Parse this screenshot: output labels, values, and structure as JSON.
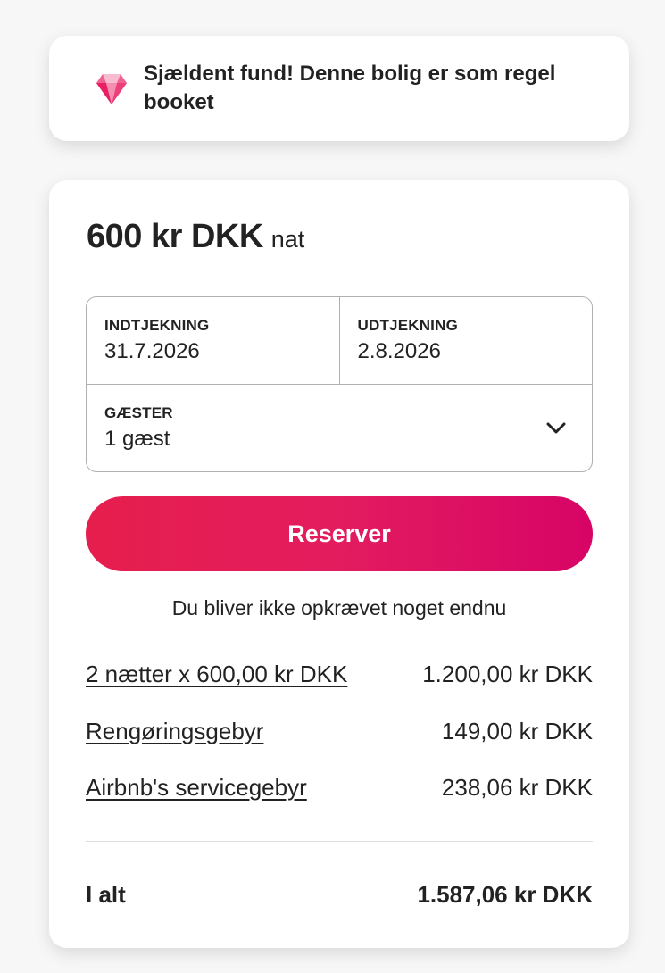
{
  "notice": {
    "icon": "gem-icon",
    "text": "Sjældent fund! Denne bolig er som regel booket"
  },
  "booking": {
    "price": "600 kr DKK",
    "price_unit": "nat",
    "checkin": {
      "label": "INDTJEKNING",
      "value": "31.7.2026"
    },
    "checkout": {
      "label": "UDTJEKNING",
      "value": "2.8.2026"
    },
    "guests": {
      "label": "GÆSTER",
      "value": "1 gæst"
    },
    "reserve_label": "Reserver",
    "no_charge_text": "Du bliver ikke opkrævet noget endnu",
    "fees": [
      {
        "label": "2 nætter x 600,00 kr DKK",
        "amount": "1.200,00 kr DKK"
      },
      {
        "label": "Rengøringsgebyr",
        "amount": "149,00 kr DKK"
      },
      {
        "label": "Airbnb's servicegebyr",
        "amount": "238,06 kr DKK"
      }
    ],
    "total": {
      "label": "I alt",
      "amount": "1.587,06 kr DKK"
    }
  },
  "colors": {
    "accent_start": "#e61e4d",
    "accent_end": "#d70466",
    "text": "#222222",
    "border": "#b0b0b0"
  }
}
